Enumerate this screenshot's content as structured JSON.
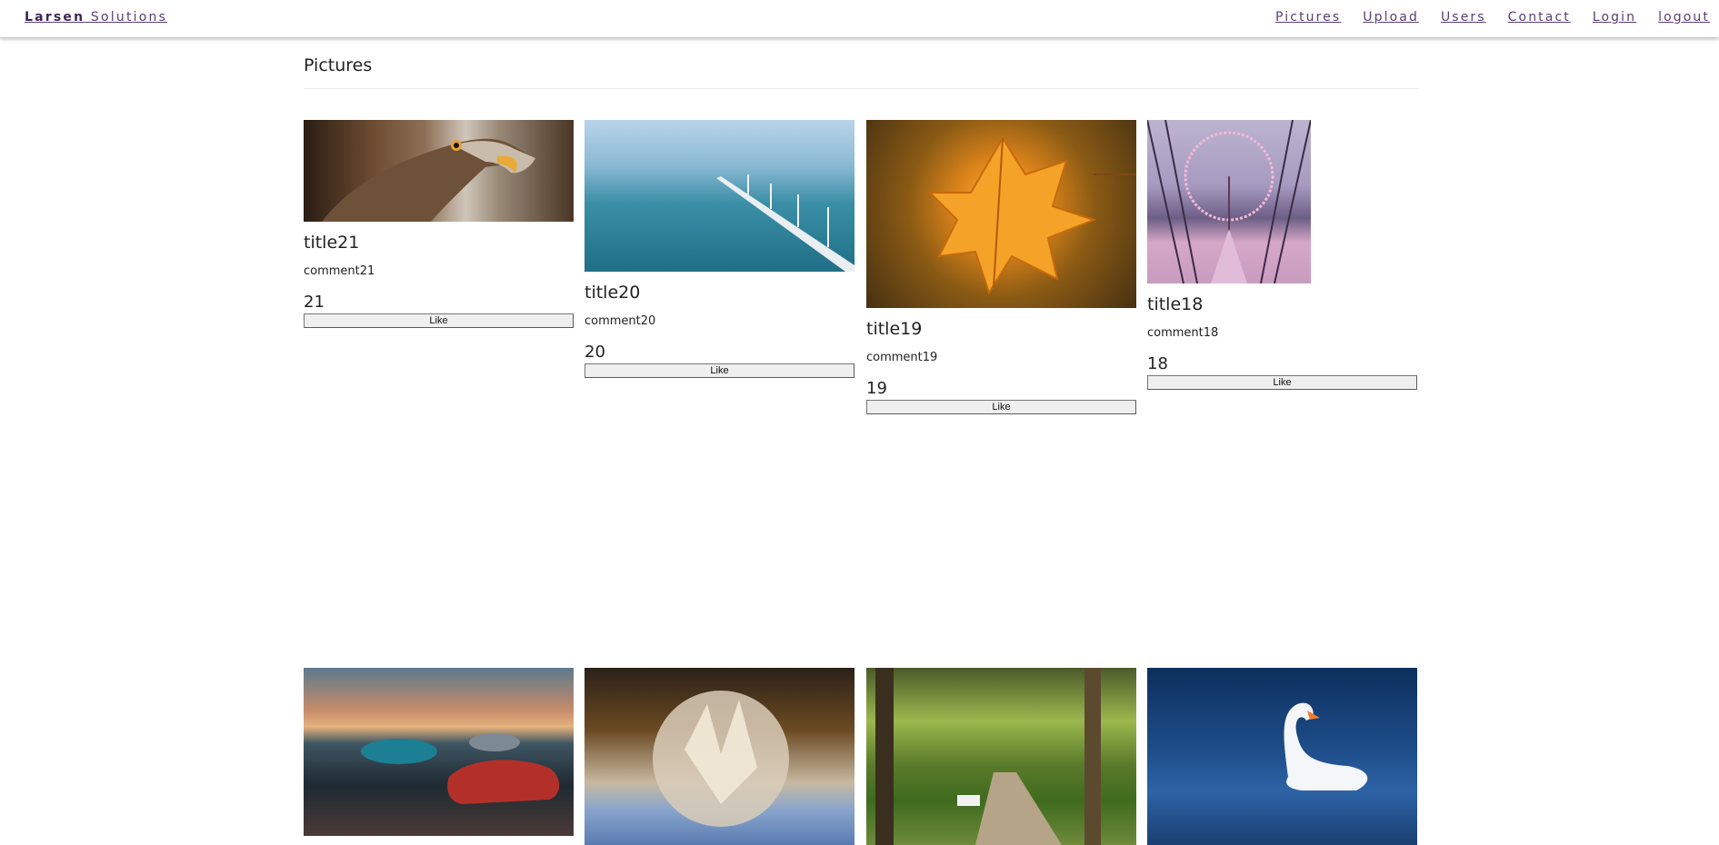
{
  "header": {
    "brand_bold": "Larsen",
    "brand_rest": " Solutions",
    "nav": [
      {
        "label": "Pictures"
      },
      {
        "label": "Upload"
      },
      {
        "label": "Users"
      },
      {
        "label": "Contact"
      },
      {
        "label": "Login"
      },
      {
        "label": "logout"
      }
    ]
  },
  "page": {
    "title": "Pictures"
  },
  "pictures": [
    {
      "title": "title21",
      "comment": "comment21",
      "likes": "21",
      "like_label": "Like"
    },
    {
      "title": "title20",
      "comment": "comment20",
      "likes": "20",
      "like_label": "Like"
    },
    {
      "title": "title19",
      "comment": "comment19",
      "likes": "19",
      "like_label": "Like"
    },
    {
      "title": "title18",
      "comment": "comment18",
      "likes": "18",
      "like_label": "Like"
    }
  ],
  "second_row": [
    {
      "subject": "cars"
    },
    {
      "subject": "frozen-bubble"
    },
    {
      "subject": "park-path"
    },
    {
      "subject": "swan"
    }
  ]
}
